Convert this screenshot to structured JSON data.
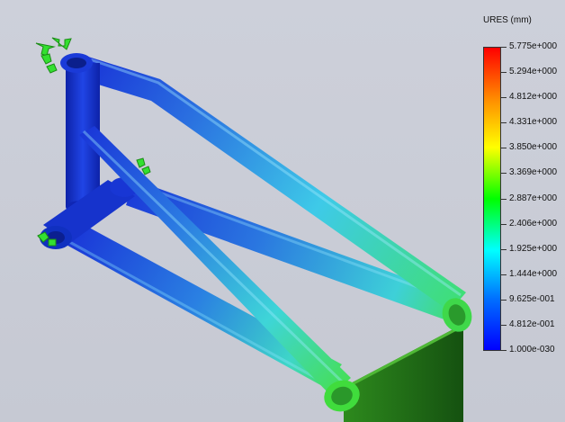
{
  "legend": {
    "title": "URES (mm)",
    "ticks": [
      "5.775e+000",
      "5.294e+000",
      "4.812e+000",
      "4.331e+000",
      "3.850e+000",
      "3.369e+000",
      "2.887e+000",
      "2.406e+000",
      "1.925e+000",
      "1.444e+000",
      "9.625e-001",
      "4.812e-001",
      "1.000e-030"
    ],
    "colors": {
      "max": "#ff0000",
      "orange": "#ff8c00",
      "yellow": "#ffff00",
      "green": "#00ff00",
      "cyan": "#00ffff",
      "blue": "#0070ff",
      "min": "#0000ff"
    }
  },
  "scene": {
    "model": "bicycle frame displacement plot",
    "colors": {
      "low": "#1533d0",
      "mid": "#3fc8e6",
      "high": "#3ce040",
      "fixture": "#35e030",
      "plate": "#1d6b12"
    }
  }
}
